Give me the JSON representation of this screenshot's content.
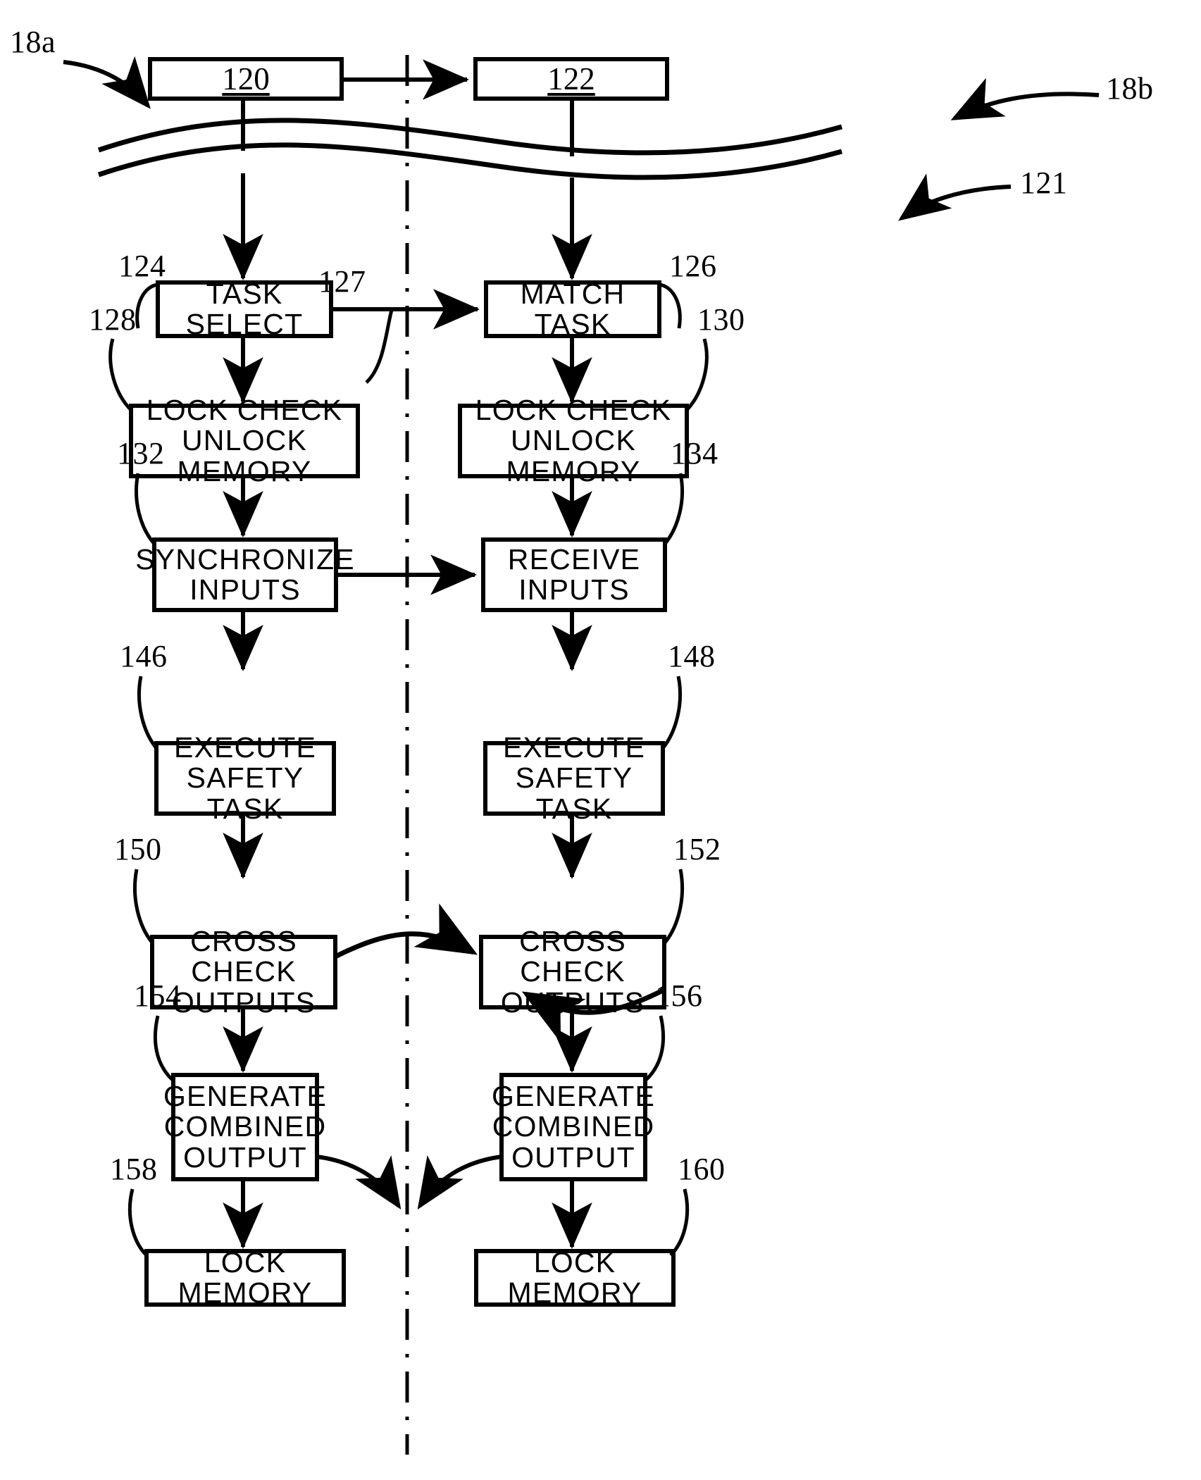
{
  "figure": {
    "type": "patent-flowchart",
    "description": "Dual-channel safety task flow diagram split by a vertical dash-dot centerline"
  },
  "callouts": [
    {
      "id": "callout-18a",
      "text": "18a"
    },
    {
      "id": "callout-18b",
      "text": "18b"
    },
    {
      "id": "callout-121",
      "text": "121"
    }
  ],
  "top_boxes": [
    {
      "id": "box-120",
      "ref": "120"
    },
    {
      "id": "box-122",
      "ref": "122"
    }
  ],
  "connector_refs": [
    {
      "id": "ref-127",
      "text": "127"
    }
  ],
  "left_column": [
    {
      "ref": "124",
      "label": "TASK SELECT"
    },
    {
      "ref": "128",
      "label": "LOCK CHECK\nUNLOCK MEMORY"
    },
    {
      "ref": "132",
      "label": "SYNCHRONIZE\nINPUTS"
    },
    {
      "ref": "146",
      "label": "EXECUTE\nSAFETY TASK"
    },
    {
      "ref": "150",
      "label": "CROSS CHECK\nOUTPUTS"
    },
    {
      "ref": "154",
      "label": "GENERATE\nCOMBINED\nOUTPUT"
    },
    {
      "ref": "158",
      "label": "LOCK MEMORY"
    }
  ],
  "right_column": [
    {
      "ref": "126",
      "label": "MATCH TASK"
    },
    {
      "ref": "130",
      "label": "LOCK CHECK\nUNLOCK MEMORY"
    },
    {
      "ref": "134",
      "label": "RECEIVE\nINPUTS"
    },
    {
      "ref": "148",
      "label": "EXECUTE\nSAFETY TASK"
    },
    {
      "ref": "152",
      "label": "CROSS CHECK\nOUTPUTS"
    },
    {
      "ref": "156",
      "label": "GENERATE\nCOMBINED\nOUTPUT"
    },
    {
      "ref": "160",
      "label": "LOCK MEMORY"
    }
  ],
  "colors": {
    "ink": "#000000",
    "paper": "#ffffff"
  }
}
